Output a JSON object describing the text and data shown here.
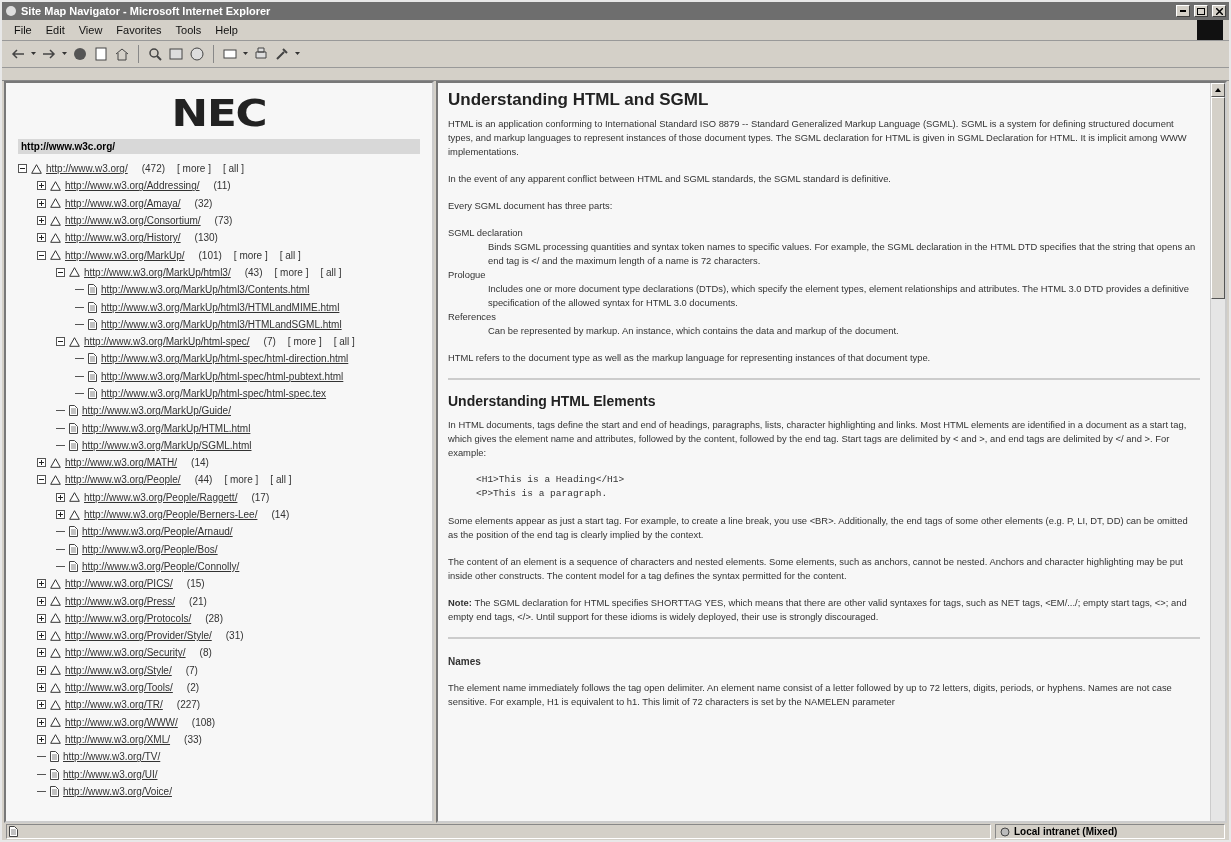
{
  "window": {
    "title": "Site Map Navigator - Microsoft Internet Explorer"
  },
  "menu": [
    "File",
    "Edit",
    "View",
    "Favorites",
    "Tools",
    "Help"
  ],
  "sitemap": {
    "logo": "NEC",
    "site": "http://www.w3c.org/",
    "tree": [
      {
        "kind": "folder",
        "url": "http://www.w3.org/",
        "count": "(472)",
        "links": [
          "[ more ]",
          "[ all ]"
        ],
        "expanded": true,
        "children": [
          {
            "kind": "folder",
            "url": "http://www.w3.org/Addressing/",
            "count": "(11)",
            "expanded": false
          },
          {
            "kind": "folder",
            "url": "http://www.w3.org/Amaya/",
            "count": "(32)",
            "expanded": false
          },
          {
            "kind": "folder",
            "url": "http://www.w3.org/Consortium/",
            "count": "(73)",
            "expanded": false
          },
          {
            "kind": "folder",
            "url": "http://www.w3.org/History/",
            "count": "(130)",
            "expanded": false
          },
          {
            "kind": "folder",
            "url": "http://www.w3.org/MarkUp/",
            "count": "(101)",
            "links": [
              "[ more ]",
              "[ all ]"
            ],
            "expanded": true,
            "children": [
              {
                "kind": "folder",
                "url": "http://www.w3.org/MarkUp/html3/",
                "count": "(43)",
                "links": [
                  "[ more ]",
                  "[ all ]"
                ],
                "expanded": true,
                "children": [
                  {
                    "kind": "page",
                    "url": "http://www.w3.org/MarkUp/html3/Contents.html"
                  },
                  {
                    "kind": "page",
                    "url": "http://www.w3.org/MarkUp/html3/HTMLandMIME.html"
                  },
                  {
                    "kind": "page",
                    "url": "http://www.w3.org/MarkUp/html3/HTMLandSGML.html"
                  }
                ]
              },
              {
                "kind": "folder",
                "url": "http://www.w3.org/MarkUp/html-spec/",
                "count": "(7)",
                "links": [
                  "[ more ]",
                  "[ all ]"
                ],
                "expanded": true,
                "children": [
                  {
                    "kind": "page",
                    "url": "http://www.w3.org/MarkUp/html-spec/html-direction.html"
                  },
                  {
                    "kind": "page",
                    "url": "http://www.w3.org/MarkUp/html-spec/html-pubtext.html"
                  },
                  {
                    "kind": "page",
                    "url": "http://www.w3.org/MarkUp/html-spec/html-spec.tex"
                  }
                ]
              },
              {
                "kind": "page",
                "url": "http://www.w3.org/MarkUp/Guide/"
              },
              {
                "kind": "page",
                "url": "http://www.w3.org/MarkUp/HTML.html"
              },
              {
                "kind": "page",
                "url": "http://www.w3.org/MarkUp/SGML.html"
              }
            ]
          },
          {
            "kind": "folder",
            "url": "http://www.w3.org/MATH/",
            "count": "(14)",
            "expanded": false
          },
          {
            "kind": "folder",
            "url": "http://www.w3.org/People/",
            "count": "(44)",
            "links": [
              "[ more ]",
              "[ all ]"
            ],
            "expanded": true,
            "children": [
              {
                "kind": "folder",
                "url": "http://www.w3.org/People/Raggett/",
                "count": "(17)",
                "expanded": false
              },
              {
                "kind": "folder",
                "url": "http://www.w3.org/People/Berners-Lee/",
                "count": "(14)",
                "expanded": false
              },
              {
                "kind": "page",
                "url": "http://www.w3.org/People/Arnaud/"
              },
              {
                "kind": "page",
                "url": "http://www.w3.org/People/Bos/"
              },
              {
                "kind": "page",
                "url": "http://www.w3.org/People/Connolly/"
              }
            ]
          },
          {
            "kind": "folder",
            "url": "http://www.w3.org/PICS/",
            "count": "(15)",
            "expanded": false
          },
          {
            "kind": "folder",
            "url": "http://www.w3.org/Press/",
            "count": "(21)",
            "expanded": false
          },
          {
            "kind": "folder",
            "url": "http://www.w3.org/Protocols/",
            "count": "(28)",
            "expanded": false
          },
          {
            "kind": "folder",
            "url": "http://www.w3.org/Provider/Style/",
            "count": "(31)",
            "expanded": false
          },
          {
            "kind": "folder",
            "url": "http://www.w3.org/Security/",
            "count": "(8)",
            "expanded": false
          },
          {
            "kind": "folder",
            "url": "http://www.w3.org/Style/",
            "count": "(7)",
            "expanded": false
          },
          {
            "kind": "folder",
            "url": "http://www.w3.org/Tools/",
            "count": "(2)",
            "expanded": false
          },
          {
            "kind": "folder",
            "url": "http://www.w3.org/TR/",
            "count": "(227)",
            "expanded": false
          },
          {
            "kind": "folder",
            "url": "http://www.w3.org/WWW/",
            "count": "(108)",
            "expanded": false
          },
          {
            "kind": "folder",
            "url": "http://www.w3.org/XML/",
            "count": "(33)",
            "expanded": false
          },
          {
            "kind": "page",
            "url": "http://www.w3.org/TV/"
          },
          {
            "kind": "page",
            "url": "http://www.w3.org/UI/"
          },
          {
            "kind": "page",
            "url": "http://www.w3.org/Voice/"
          }
        ]
      }
    ]
  },
  "document": [
    {
      "kind": "heading",
      "text": "Understanding HTML and SGML"
    },
    {
      "kind": "paragraph",
      "text": "HTML is an application conforming to International Standard ISO 8879 -- Standard Generalized Markup Language (SGML). SGML is a system for defining structured document types, and markup languages to represent instances of those document types. The SGML declaration for HTML is given in SGML Declaration for HTML. It is implicit among WWW implementations."
    },
    {
      "kind": "paragraph",
      "text": "In the event of any apparent conflict between HTML and SGML standards, the SGML standard is definitive."
    },
    {
      "kind": "paragraph",
      "text": "Every SGML document has three parts:"
    },
    {
      "kind": "definitions",
      "items": [
        {
          "term": "SGML declaration",
          "definition": "Binds SGML processing quantities and syntax token names to specific values. For example, the SGML declaration in the HTML DTD specifies that the string that opens an end tag is </ and the maximum length of a name is 72 characters."
        },
        {
          "term": "Prologue",
          "definition": "Includes one or more document type declarations (DTDs), which specify the element types, element relationships and attributes. The HTML 3.0 DTD provides a definitive specification of the allowed syntax for HTML 3.0 documents."
        },
        {
          "term": "References",
          "definition": "Can be represented by markup. An instance, which contains the data and markup of the document."
        }
      ]
    },
    {
      "kind": "paragraph",
      "text": "HTML refers to the document type as well as the markup language for representing instances of that document type."
    },
    {
      "kind": "rule"
    },
    {
      "kind": "heading2",
      "text": "Understanding HTML Elements"
    },
    {
      "kind": "paragraph",
      "text": "In HTML documents, tags define the start and end of headings, paragraphs, lists, character highlighting and links. Most HTML elements are identified in a document as a start tag, which gives the element name and attributes, followed by the content, followed by the end tag. Start tags are delimited by < and >, and end tags are delimited by </ and >. For example:"
    },
    {
      "kind": "code",
      "lines": [
        "<H1>This is a Heading</H1>",
        "<P>This is a paragraph."
      ]
    },
    {
      "kind": "paragraph",
      "text": "Some elements appear as just a start tag. For example, to create a line break, you use <BR>. Additionally, the end tags of some other elements (e.g. P, LI, DT, DD) can be omitted as the position of the end tag is clearly implied by the context."
    },
    {
      "kind": "paragraph",
      "text": "The content of an element is a sequence of characters and nested elements. Some elements, such as anchors, cannot be nested. Anchors and character highlighting may be put inside other constructs. The content model for a tag defines the syntax permitted for the content."
    },
    {
      "kind": "paragraph",
      "text": "**Note:** The SGML declaration for HTML specifies SHORTTAG YES, which means that there are other valid syntaxes for tags, such as NET tags, <EM/.../; empty start tags, <>; and empty end tags, </>. Until support for these idioms is widely deployed, their use is strongly discouraged."
    },
    {
      "kind": "rule"
    },
    {
      "kind": "heading3",
      "text": "Names"
    },
    {
      "kind": "paragraph",
      "text": "The element name immediately follows the tag open delimiter. An element name consist of a letter followed by up to 72 letters, digits, periods, or hyphens. Names are not case sensitive. For example, H1 is equivalent to h1. This limit of 72 characters is set by the NAMELEN parameter"
    }
  ],
  "status_bar": {
    "zone": "Local intranet (Mixed)"
  }
}
